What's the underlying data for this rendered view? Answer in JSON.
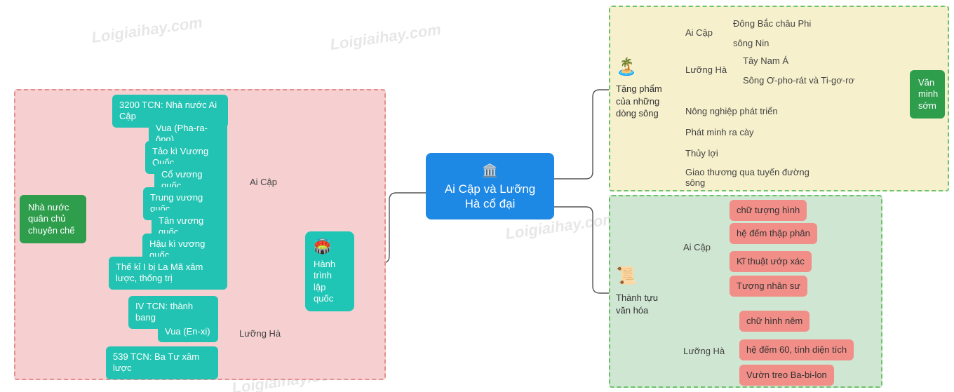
{
  "root": {
    "title": "Ai Cập và Lưỡng Hà cổ đại"
  },
  "watermark": "Loigiaihay.com",
  "branches": {
    "formation": {
      "label": "Hành trình lập quốc",
      "midEgypt": "Ai Cập",
      "midMeso": "Lưỡng Hà",
      "sideLabel": "Nhà nước quân chủ chuyên chế",
      "egyptItems": [
        "3200 TCN: Nhà nước Ai Cập",
        "Vua (Pha-ra-ông)",
        "Tảo kì Vương Quốc",
        "Cổ vương quốc",
        "Trung vương quốc",
        "Tân vương quốc",
        "Hậu kì vương quốc",
        "Thế kỉ I bị La Mã xâm lược, thống trị"
      ],
      "mesoItems": [
        "IV TCN: thành bang",
        "Vua (En-xi)",
        "539 TCN: Ba Tư xâm lược"
      ]
    },
    "rivers": {
      "label": "Tặng phẩm của những dòng sông",
      "sideLabel": "Văn minh sớm",
      "midEgypt": "Ai Cập",
      "midMeso": "Lưỡng Hà",
      "egyptItems": [
        "Đông Bắc châu Phi",
        "sông Nin"
      ],
      "mesoItems": [
        "Tây Nam Á",
        "Sông Ơ-pho-rát và Ti-gơ-rơ"
      ],
      "commonItems": [
        "Nông nghiệp phát triển",
        "Phát minh ra cày",
        "Thủy lợi",
        "Giao thương qua tuyến đường sông"
      ]
    },
    "culture": {
      "label": "Thành tựu văn hóa",
      "midEgypt": "Ai Cập",
      "midMeso": "Lưỡng Hà",
      "egyptItems": [
        "chữ tượng hình",
        "hệ đếm thập phân",
        "Kĩ thuật ướp xác",
        "Tượng nhân sư"
      ],
      "mesoItems": [
        "chữ hình nêm",
        "hệ đếm 60, tính diện tích",
        "Vườn treo Ba-bi-lon"
      ]
    }
  }
}
